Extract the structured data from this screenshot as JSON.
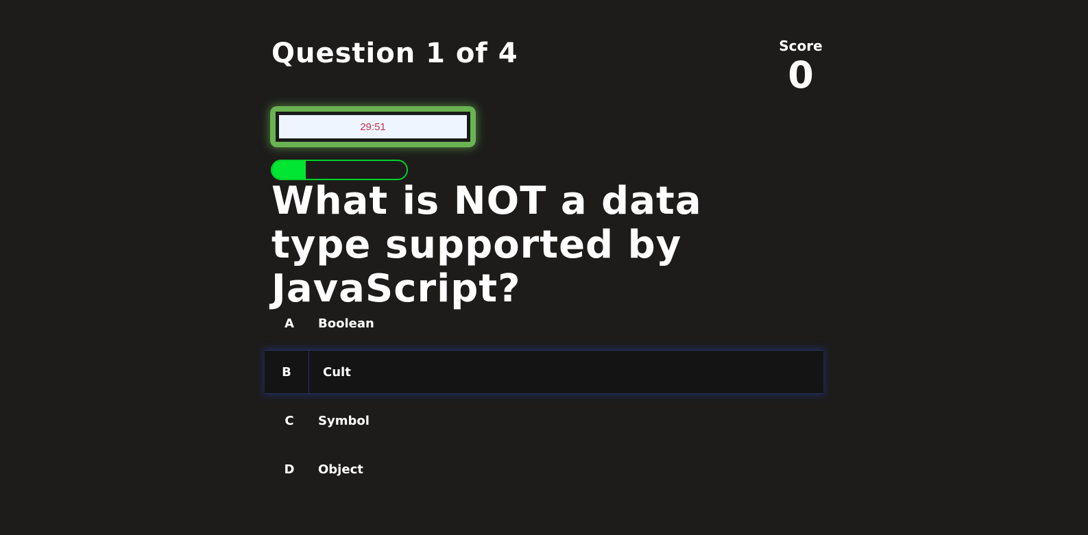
{
  "header": {
    "question_counter": "Question 1 of 4",
    "score_label": "Score",
    "score_value": "0"
  },
  "timer": {
    "display": "29:51"
  },
  "progress": {
    "fraction": 0.25
  },
  "question": {
    "text": "What is NOT a data type supported by JavaScript?"
  },
  "options": [
    {
      "letter": "A",
      "text": "Boolean"
    },
    {
      "letter": "B",
      "text": "Cult"
    },
    {
      "letter": "C",
      "text": "Symbol"
    },
    {
      "letter": "D",
      "text": "Object"
    }
  ],
  "colors": {
    "background": "#1d1c1b",
    "timer_frame": "#6ab352",
    "timer_text": "#c4324a",
    "progress": "#00e633",
    "hover_glow": "#283caa"
  }
}
